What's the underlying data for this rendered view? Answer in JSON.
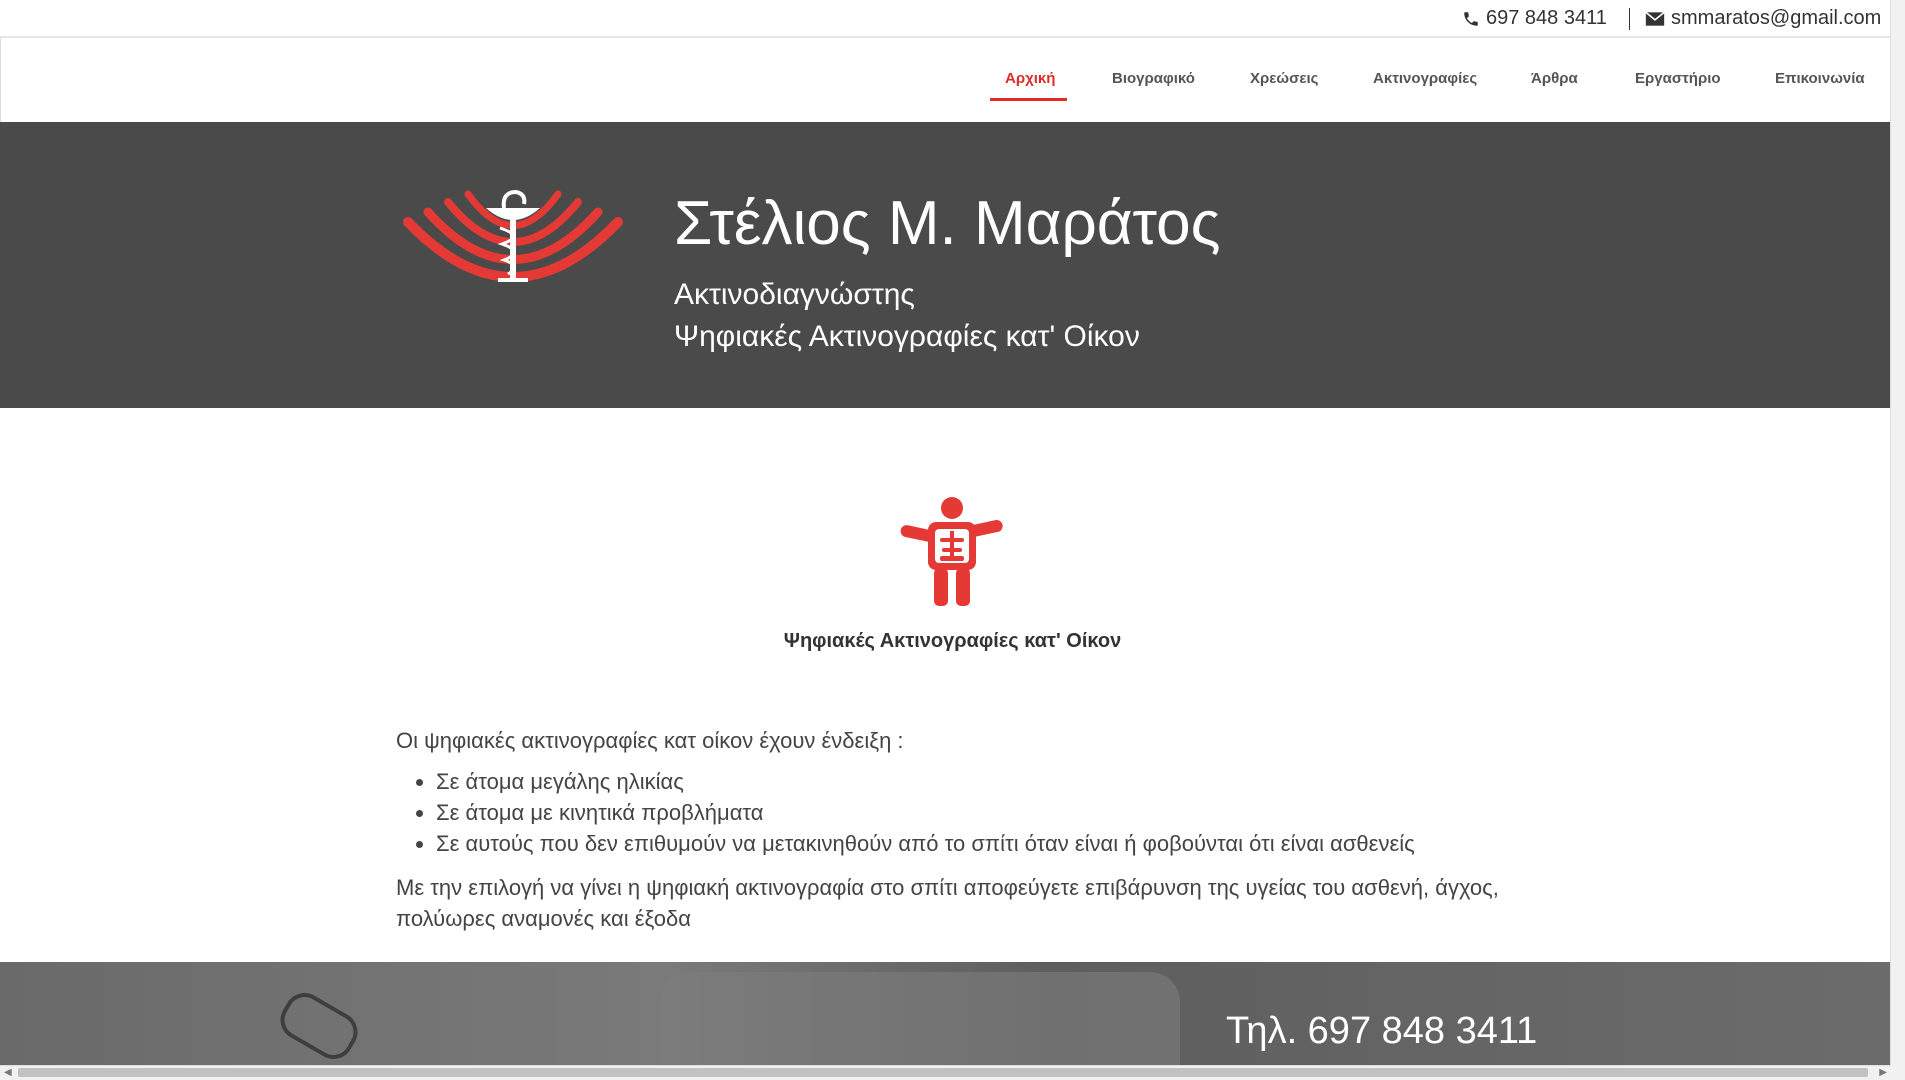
{
  "contact": {
    "phone": "697 848 3411",
    "email": "smmaratos@gmail.com",
    "phone_icon": "phone-icon",
    "email_icon": "envelope-icon"
  },
  "nav": {
    "items": [
      {
        "label": "Αρχική",
        "active": true
      },
      {
        "label": "Βιογραφικό",
        "active": false
      },
      {
        "label": "Χρεώσεις",
        "active": false
      },
      {
        "label": "Ακτινογραφίες",
        "active": false
      },
      {
        "label": "Άρθρα",
        "active": false
      },
      {
        "label": "Εργαστήριο",
        "active": false
      },
      {
        "label": "Επικοινωνία",
        "active": false
      }
    ]
  },
  "hero": {
    "name": "Στέλιος Μ. Μαράτος",
    "subtitle1": "Ακτινοδιαγνώστης",
    "subtitle2": "Ψηφιακές Ακτινογραφίες κατ' Οίκον",
    "logo_icon": "radiology-caduceus-logo"
  },
  "feature": {
    "icon": "xray-person-icon",
    "title": "Ψηφιακές Ακτινογραφίες κατ' Οίκον"
  },
  "content": {
    "intro": "Οι ψηφιακές ακτινογραφίες κατ οίκον έχουν ένδειξη :",
    "bullets": [
      "Σε άτομα μεγάλης ηλικίας",
      "Σε άτομα με κινητικά προβλήματα",
      "Σε αυτούς που δεν επιθυμούν να μετακινηθούν από το σπίτι όταν είναι ή φοβούνται ότι είναι ασθενείς"
    ],
    "outro": "Με την επιλογή να γίνει η ψηφιακή ακτινογραφία στο σπίτι αποφεύγετε επιβάρυνση της υγείας του ασθενή, άγχος, πολύωρες αναμονές και έξοδα"
  },
  "footer": {
    "phone": "Τηλ. 697 848 3411"
  },
  "colors": {
    "accent": "#e02b27",
    "hero_bg": "#4a4a4a"
  }
}
